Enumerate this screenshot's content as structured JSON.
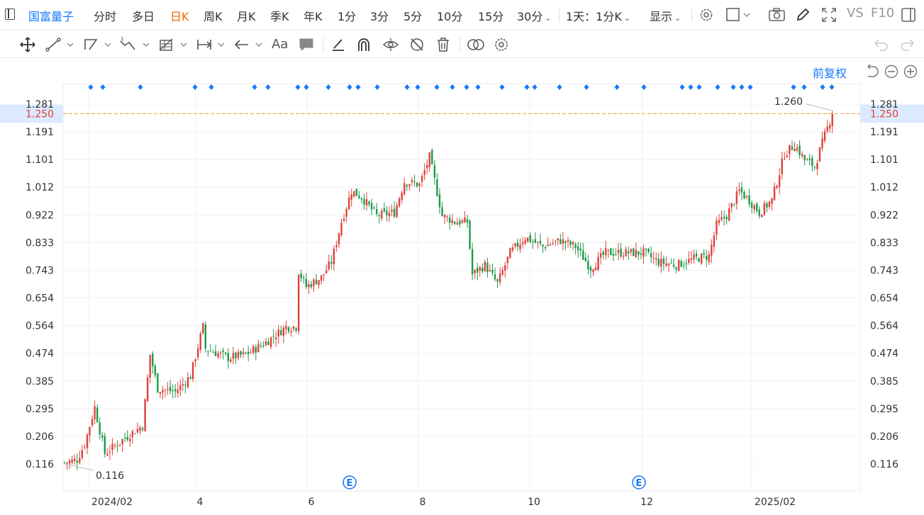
{
  "toolbar": {
    "stock_name": "国富量子",
    "tabs": [
      {
        "label": "分时"
      },
      {
        "label": "多日"
      },
      {
        "label": "日K",
        "active": true
      },
      {
        "label": "周K"
      },
      {
        "label": "月K"
      },
      {
        "label": "季K"
      },
      {
        "label": "年K"
      },
      {
        "label": "1分"
      },
      {
        "label": "3分"
      },
      {
        "label": "5分"
      },
      {
        "label": "10分"
      },
      {
        "label": "15分"
      },
      {
        "label": "30分"
      }
    ],
    "period_selector": "1天：1分K",
    "display_menu": "显示",
    "vs_label": "VS",
    "f10_label": "F10"
  },
  "drawing_tools": [
    "move-tool-icon",
    "line-tool-icon",
    "polyline-tool-icon",
    "wave-tool-icon",
    "measure-tool-icon",
    "range-tool-icon",
    "arrow-tool-icon",
    "text-tool-icon",
    "comment-tool-icon",
    "pen-tool-icon",
    "magnet-icon",
    "visibility-icon",
    "hide-drawings-icon",
    "trash-icon",
    "link-icon",
    "tool-settings-icon"
  ],
  "chart": {
    "adjust_mode": "前复权",
    "current_price": "1.250",
    "high_label": "1.260",
    "low_label": "0.116",
    "event_marker": "E",
    "colors": {
      "up": "#e0403a",
      "down": "#1a9a4a",
      "accent": "#1677ff",
      "price_line": "#f0a030"
    }
  },
  "chart_data": {
    "type": "candlestick",
    "y_ticks": [
      "1.281",
      "1.191",
      "1.101",
      "1.012",
      "0.922",
      "0.833",
      "0.743",
      "0.654",
      "0.564",
      "0.474",
      "0.385",
      "0.295",
      "0.206",
      "0.116"
    ],
    "x_ticks": [
      "2024/02",
      "4",
      "6",
      "8",
      "10",
      "12",
      "2025/02"
    ],
    "ylim": [
      0.116,
      1.281
    ],
    "current_price": 1.25,
    "high": 1.26,
    "low": 0.116,
    "close_path": [
      [
        0,
        0.12
      ],
      [
        5,
        0.13
      ],
      [
        8,
        0.18
      ],
      [
        12,
        0.3
      ],
      [
        16,
        0.15
      ],
      [
        24,
        0.2
      ],
      [
        31,
        0.24
      ],
      [
        34,
        0.47
      ],
      [
        37,
        0.36
      ],
      [
        44,
        0.35
      ],
      [
        50,
        0.4
      ],
      [
        55,
        0.56
      ],
      [
        56,
        0.49
      ],
      [
        65,
        0.46
      ],
      [
        72,
        0.47
      ],
      [
        80,
        0.51
      ],
      [
        88,
        0.56
      ],
      [
        92,
        0.56
      ],
      [
        93,
        0.74
      ],
      [
        96,
        0.69
      ],
      [
        102,
        0.72
      ],
      [
        106,
        0.77
      ],
      [
        110,
        0.9
      ],
      [
        114,
        1.0
      ],
      [
        118,
        0.98
      ],
      [
        124,
        0.92
      ],
      [
        131,
        0.93
      ],
      [
        135,
        1.03
      ],
      [
        141,
        1.02
      ],
      [
        145,
        1.11
      ],
      [
        150,
        0.92
      ],
      [
        155,
        0.9
      ],
      [
        160,
        0.9
      ],
      [
        162,
        0.73
      ],
      [
        167,
        0.76
      ],
      [
        172,
        0.7
      ],
      [
        177,
        0.8
      ],
      [
        183,
        0.85
      ],
      [
        190,
        0.82
      ],
      [
        197,
        0.84
      ],
      [
        203,
        0.82
      ],
      [
        209,
        0.75
      ],
      [
        215,
        0.8
      ],
      [
        222,
        0.8
      ],
      [
        230,
        0.8
      ],
      [
        236,
        0.77
      ],
      [
        243,
        0.76
      ],
      [
        250,
        0.78
      ],
      [
        256,
        0.79
      ],
      [
        259,
        0.89
      ],
      [
        263,
        0.92
      ],
      [
        268,
        1.0
      ],
      [
        272,
        0.97
      ],
      [
        276,
        0.93
      ],
      [
        281,
        0.97
      ],
      [
        286,
        1.12
      ],
      [
        290,
        1.15
      ],
      [
        294,
        1.1
      ],
      [
        298,
        1.08
      ],
      [
        302,
        1.18
      ],
      [
        305,
        1.25
      ]
    ],
    "event_marker_days": [
      103,
      213
    ]
  }
}
